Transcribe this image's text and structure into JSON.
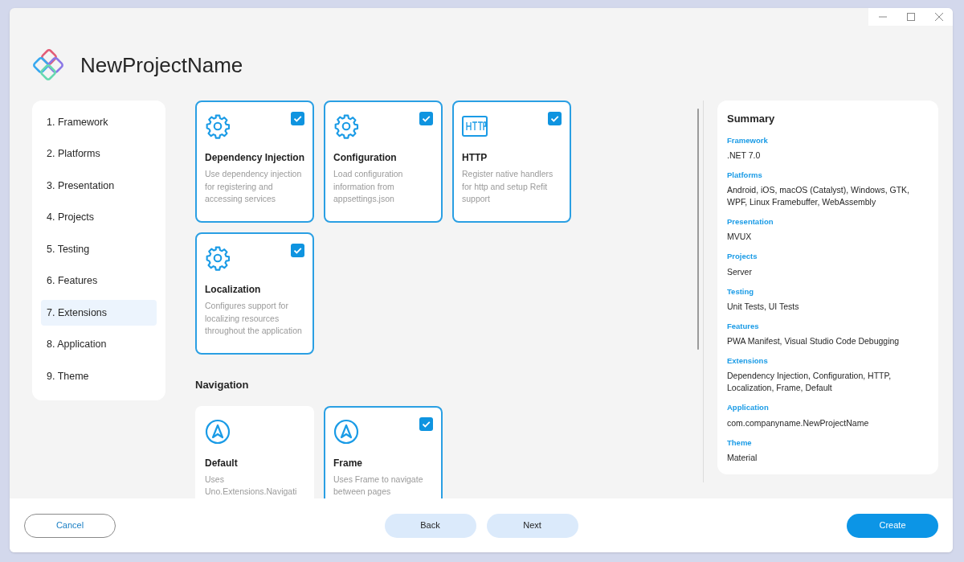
{
  "window": {
    "title": "NewProjectName"
  },
  "steps": [
    {
      "label": "1. Framework",
      "selected": false
    },
    {
      "label": "2. Platforms",
      "selected": false
    },
    {
      "label": "3. Presentation",
      "selected": false
    },
    {
      "label": "4. Projects",
      "selected": false
    },
    {
      "label": "5. Testing",
      "selected": false
    },
    {
      "label": "6. Features",
      "selected": false
    },
    {
      "label": "7. Extensions",
      "selected": true
    },
    {
      "label": "8. Application",
      "selected": false
    },
    {
      "label": "9. Theme",
      "selected": false
    }
  ],
  "sections": [
    {
      "cards": [
        {
          "kind": "gear",
          "title": "Dependency Injection",
          "description": "Use dependency injection for registering and accessing services",
          "checked": true
        },
        {
          "kind": "gear",
          "title": "Configuration",
          "description": "Load configuration information from appsettings.json",
          "checked": true
        },
        {
          "kind": "http",
          "title": "HTTP",
          "description": "Register native handlers for http and setup Refit support",
          "checked": true
        },
        {
          "kind": "gear",
          "title": "Localization",
          "description": "Configures support for localizing resources throughout the application",
          "checked": true
        }
      ]
    },
    {
      "heading": "Navigation",
      "cards": [
        {
          "kind": "navigation",
          "title": "Default",
          "description": "Uses Uno.Extensions.Navigati",
          "checked": false
        },
        {
          "kind": "navigation",
          "title": "Frame",
          "description": "Uses Frame to navigate between pages",
          "checked": true
        }
      ]
    }
  ],
  "summary": {
    "title": "Summary",
    "items": [
      {
        "label": "Framework",
        "value": ".NET 7.0"
      },
      {
        "label": "Platforms",
        "value": "Android, iOS, macOS (Catalyst), Windows, GTK, WPF, Linux Framebuffer, WebAssembly"
      },
      {
        "label": "Presentation",
        "value": "MVUX"
      },
      {
        "label": "Projects",
        "value": "Server"
      },
      {
        "label": "Testing",
        "value": "Unit Tests, UI Tests"
      },
      {
        "label": "Features",
        "value": "PWA Manifest, Visual Studio Code Debugging"
      },
      {
        "label": "Extensions",
        "value": "Dependency Injection, Configuration, HTTP, Localization, Frame, Default"
      },
      {
        "label": "Application",
        "value": "com.companyname.NewProjectName"
      },
      {
        "label": "Theme",
        "value": "Material"
      }
    ]
  },
  "buttons": [
    {
      "label": "Cancel",
      "kind": "outline"
    },
    {
      "label": "Back",
      "kind": "soft"
    },
    {
      "label": "Next",
      "kind": "soft"
    },
    {
      "label": "Create",
      "kind": "primary"
    }
  ]
}
